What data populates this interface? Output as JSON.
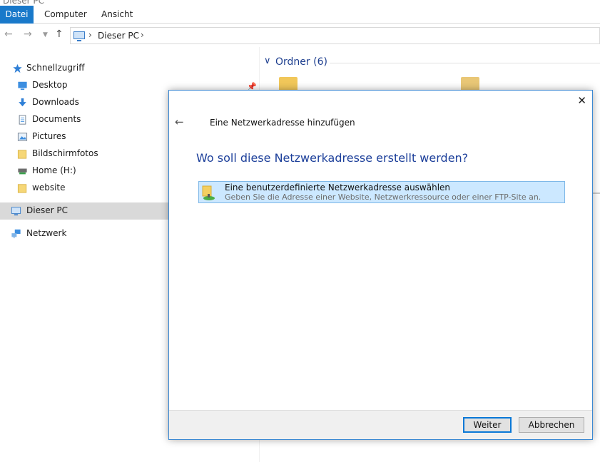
{
  "window": {
    "title_fragment": "Dieser PC"
  },
  "ribbon": {
    "tabs": [
      "Datei",
      "Computer",
      "Ansicht"
    ]
  },
  "navbar": {
    "breadcrumb": "Dieser PC"
  },
  "sidebar": {
    "items": [
      {
        "label": "Schnellzugriff",
        "icon": "star-icon"
      },
      {
        "label": "Desktop",
        "icon": "desktop-icon"
      },
      {
        "label": "Downloads",
        "icon": "download-icon"
      },
      {
        "label": "Documents",
        "icon": "document-icon"
      },
      {
        "label": "Pictures",
        "icon": "pictures-icon"
      },
      {
        "label": "Bildschirmfotos",
        "icon": "folder-icon"
      },
      {
        "label": "Home (H:)",
        "icon": "drive-icon"
      },
      {
        "label": "website",
        "icon": "folder-icon"
      },
      {
        "label": "Dieser PC",
        "icon": "computer-icon",
        "selected": true
      },
      {
        "label": "Netzwerk",
        "icon": "network-icon"
      }
    ]
  },
  "content": {
    "group_title": "Ordner (6)"
  },
  "dialog": {
    "title": "Eine Netzwerkadresse hinzufügen",
    "heading": "Wo soll diese Netzwerkadresse erstellt werden?",
    "option": {
      "title": "Eine benutzerdefinierte Netzwerkadresse auswählen",
      "description": "Geben Sie die Adresse einer Website, Netzwerkressource oder einer FTP-Site an."
    },
    "buttons": {
      "next": "Weiter",
      "cancel": "Abbrechen"
    }
  },
  "colors": {
    "accent": "#1979ca",
    "heading": "#1c3f9a",
    "selection": "#cce8ff",
    "sidebar_selected": "#d9d9d9"
  }
}
